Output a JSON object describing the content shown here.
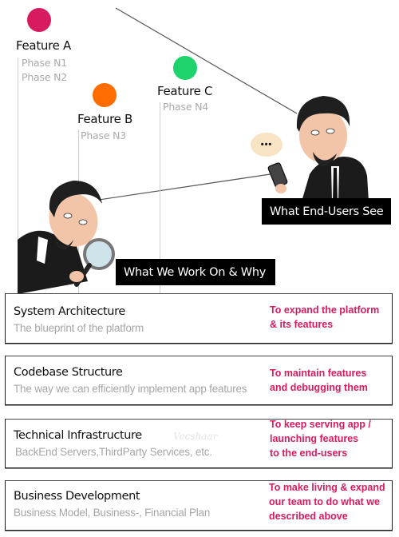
{
  "colors": {
    "feature_a": "#d81b60",
    "feature_b": "#ff6d00",
    "feature_c": "#1ed36c",
    "reason_text": "#d81b60",
    "label_bg": "#000000"
  },
  "features": [
    {
      "name": "Feature A",
      "phases": [
        "Phase N1",
        "Phase N2"
      ]
    },
    {
      "name": "Feature B",
      "phases": [
        "Phase N3"
      ]
    },
    {
      "name": "Feature C",
      "phases": [
        "Phase N4"
      ]
    }
  ],
  "characters": {
    "end_user": {
      "label": "What End-Users See",
      "speech_bubble": "•••",
      "icon": "man-with-phone-avatar"
    },
    "developer": {
      "label": "What We Work On & Why",
      "icon": "man-with-magnifier-avatar"
    }
  },
  "layers": [
    {
      "title": "System Architecture",
      "subtitle": "The blueprint of the platform",
      "reason": "To expand the platform\n& its features"
    },
    {
      "title": "Codebase Structure",
      "subtitle": "The way we can efficiently implement app features",
      "reason": "To maintain features\nand debugging them"
    },
    {
      "title": "Technical Infrastructure",
      "subtitle": "BackEnd Servers,ThirdParty Services, etc.",
      "reason": "To keep serving app /\nlaunching features\nto the end-users"
    },
    {
      "title": "Business Development",
      "subtitle": "Business Model, Business-, Financial Plan",
      "reason": "To make living & expand\nour team to do what we\ndescribed above"
    }
  ],
  "watermark": "Vecshaar"
}
